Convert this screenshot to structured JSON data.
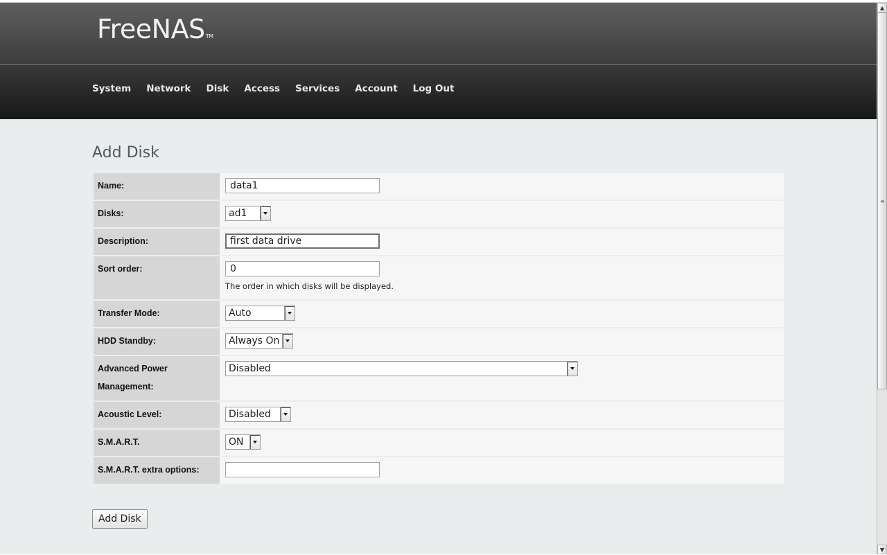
{
  "app": {
    "logo_text": "FreeNAS",
    "logo_tm": "TM"
  },
  "nav": {
    "items": [
      {
        "label": "System"
      },
      {
        "label": "Network"
      },
      {
        "label": "Disk"
      },
      {
        "label": "Access"
      },
      {
        "label": "Services"
      },
      {
        "label": "Account"
      },
      {
        "label": "Log Out"
      }
    ]
  },
  "page": {
    "title": "Add Disk"
  },
  "form": {
    "name": {
      "label": "Name:",
      "value": "data1"
    },
    "disks": {
      "label": "Disks:",
      "value": "ad1"
    },
    "description": {
      "label": "Description:",
      "value": "first data drive"
    },
    "sort_order": {
      "label": "Sort order:",
      "value": "0",
      "help": "The order in which disks will be displayed."
    },
    "transfer_mode": {
      "label": "Transfer Mode:",
      "value": "Auto"
    },
    "hdd_standby": {
      "label": "HDD Standby:",
      "value": "Always On"
    },
    "apm": {
      "label_line1": "Advanced Power",
      "label_line2": "Management:",
      "value": "Disabled"
    },
    "acoustic_level": {
      "label": "Acoustic Level:",
      "value": "Disabled"
    },
    "smart": {
      "label": "S.M.A.R.T.",
      "value": "ON"
    },
    "smart_extra": {
      "label": "S.M.A.R.T. extra options:",
      "value": ""
    },
    "submit_label": "Add Disk"
  },
  "icons": {
    "scroll_up": "chevron-up-icon",
    "scroll_down": "chevron-down-icon",
    "dropdown": "dropdown-arrow-icon"
  }
}
